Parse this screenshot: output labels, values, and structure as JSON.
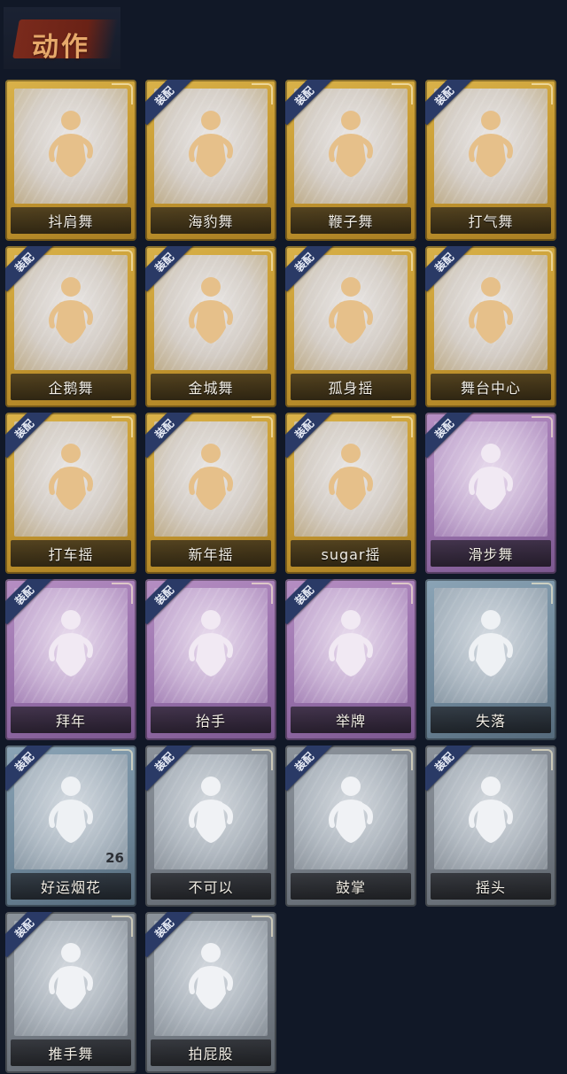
{
  "header": {
    "title": "动作"
  },
  "badge_label": "装配",
  "cards": [
    {
      "label": "抖肩舞",
      "equipped": false,
      "rarity": "gold",
      "icon": "shrug-dance-icon"
    },
    {
      "label": "海豹舞",
      "equipped": true,
      "rarity": "gold",
      "icon": "seal-dance-icon"
    },
    {
      "label": "鞭子舞",
      "equipped": true,
      "rarity": "gold",
      "icon": "whip-dance-icon"
    },
    {
      "label": "打气舞",
      "equipped": true,
      "rarity": "gold",
      "icon": "cheer-dance-icon"
    },
    {
      "label": "企鹅舞",
      "equipped": true,
      "rarity": "gold",
      "icon": "penguin-dance-icon"
    },
    {
      "label": "金城舞",
      "equipped": true,
      "rarity": "gold",
      "icon": "golden-city-dance-icon"
    },
    {
      "label": "孤身摇",
      "equipped": true,
      "rarity": "gold",
      "icon": "solo-sway-icon"
    },
    {
      "label": "舞台中心",
      "equipped": true,
      "rarity": "gold",
      "icon": "center-stage-icon"
    },
    {
      "label": "打车摇",
      "equipped": true,
      "rarity": "gold",
      "icon": "taxi-sway-icon"
    },
    {
      "label": "新年摇",
      "equipped": true,
      "rarity": "gold",
      "icon": "new-year-sway-icon"
    },
    {
      "label": "sugar摇",
      "equipped": true,
      "rarity": "gold",
      "icon": "sugar-sway-icon"
    },
    {
      "label": "滑步舞",
      "equipped": true,
      "rarity": "purple",
      "icon": "slide-dance-icon"
    },
    {
      "label": "拜年",
      "equipped": true,
      "rarity": "purple",
      "icon": "new-year-greeting-icon"
    },
    {
      "label": "抬手",
      "equipped": true,
      "rarity": "purple",
      "icon": "raise-hand-icon"
    },
    {
      "label": "举牌",
      "equipped": true,
      "rarity": "purple",
      "icon": "hold-sign-icon"
    },
    {
      "label": "失落",
      "equipped": false,
      "rarity": "blue",
      "icon": "dejected-icon"
    },
    {
      "label": "好运烟花",
      "equipped": true,
      "rarity": "blue",
      "icon": "lucky-firework-icon",
      "count": "26"
    },
    {
      "label": "不可以",
      "equipped": true,
      "rarity": "gray",
      "icon": "no-finger-icon"
    },
    {
      "label": "鼓掌",
      "equipped": true,
      "rarity": "gray",
      "icon": "clap-icon"
    },
    {
      "label": "摇头",
      "equipped": true,
      "rarity": "gray",
      "icon": "shake-head-icon"
    },
    {
      "label": "推手舞",
      "equipped": true,
      "rarity": "gray",
      "icon": "push-hands-dance-icon"
    },
    {
      "label": "拍屁股",
      "equipped": true,
      "rarity": "gray",
      "icon": "slap-butt-icon"
    }
  ]
}
